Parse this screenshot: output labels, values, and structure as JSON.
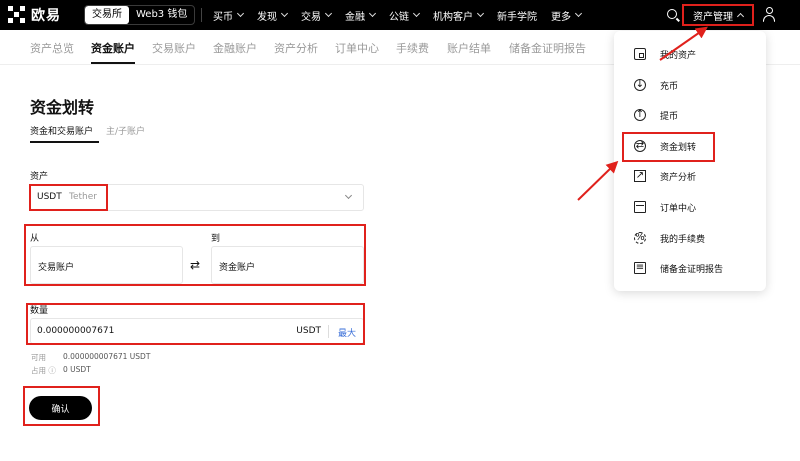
{
  "header": {
    "logo_text": "欧易",
    "segments": [
      "交易所",
      "Web3 钱包"
    ],
    "nav": [
      "买币",
      "发现",
      "交易",
      "金融",
      "公链",
      "机构客户",
      "新手学院",
      "更多"
    ],
    "asset_menu_label": "资产管理"
  },
  "subtabs": [
    "资产总览",
    "资金账户",
    "交易账户",
    "金融账户",
    "资产分析",
    "订单中心",
    "手续费",
    "账户结单",
    "储备金证明报告"
  ],
  "main": {
    "title": "资金划转",
    "inner_tabs": [
      "资金和交易账户",
      "主/子账户"
    ],
    "asset_label": "资产",
    "asset_symbol": "USDT",
    "asset_name": "Tether",
    "from_label": "从",
    "to_label": "到",
    "from_account": "交易账户",
    "to_account": "资金账户",
    "swap_glyph": "⇄",
    "qty_label": "数量",
    "qty_value": "0.000000007671",
    "qty_unit": "USDT",
    "qty_max": "最大",
    "available_label": "可用",
    "available_value": "0.000000007671 USDT",
    "occupied_label": "占用 ⓘ",
    "occupied_value": "0 USDT",
    "confirm": "确认"
  },
  "dropdown": {
    "items": [
      {
        "label": "我的资产",
        "icon": "wallet-icon"
      },
      {
        "label": "充币",
        "icon": "deposit-icon"
      },
      {
        "label": "提币",
        "icon": "withdraw-icon"
      },
      {
        "label": "资金划转",
        "icon": "transfer-icon"
      },
      {
        "label": "资产分析",
        "icon": "analysis-icon"
      },
      {
        "label": "订单中心",
        "icon": "order-icon"
      },
      {
        "label": "我的手续费",
        "icon": "fee-icon"
      },
      {
        "label": "储备金证明报告",
        "icon": "report-icon"
      }
    ]
  },
  "colors": {
    "highlight": "#e0211c",
    "accent_link": "#3a6fd8",
    "nav_bg": "#000000"
  }
}
